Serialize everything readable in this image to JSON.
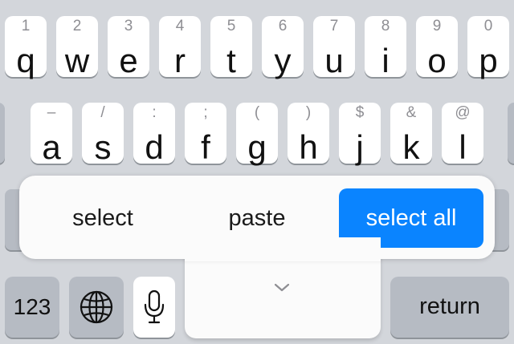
{
  "keyboard": {
    "row1": [
      {
        "letter": "q",
        "secondary": "1"
      },
      {
        "letter": "w",
        "secondary": "2"
      },
      {
        "letter": "e",
        "secondary": "3"
      },
      {
        "letter": "r",
        "secondary": "4"
      },
      {
        "letter": "t",
        "secondary": "5"
      },
      {
        "letter": "y",
        "secondary": "6"
      },
      {
        "letter": "u",
        "secondary": "7"
      },
      {
        "letter": "i",
        "secondary": "8"
      },
      {
        "letter": "o",
        "secondary": "9"
      },
      {
        "letter": "p",
        "secondary": "0"
      }
    ],
    "row2": [
      {
        "letter": "a",
        "secondary": "–"
      },
      {
        "letter": "s",
        "secondary": "/"
      },
      {
        "letter": "d",
        "secondary": ":"
      },
      {
        "letter": "f",
        "secondary": ";"
      },
      {
        "letter": "g",
        "secondary": "("
      },
      {
        "letter": "h",
        "secondary": ")"
      },
      {
        "letter": "j",
        "secondary": "$"
      },
      {
        "letter": "k",
        "secondary": "&"
      },
      {
        "letter": "l",
        "secondary": "@"
      }
    ],
    "bottom": {
      "numbers_label": "123",
      "globe_icon": "globe-icon",
      "mic_icon": "microphone-icon",
      "return_label": "return"
    }
  },
  "edit_menu": {
    "items": [
      {
        "label": "select",
        "active": false
      },
      {
        "label": "paste",
        "active": false
      },
      {
        "label": "select all",
        "active": true
      }
    ],
    "active_color": "#0a84ff",
    "collapse_icon": "chevron-down-icon"
  }
}
